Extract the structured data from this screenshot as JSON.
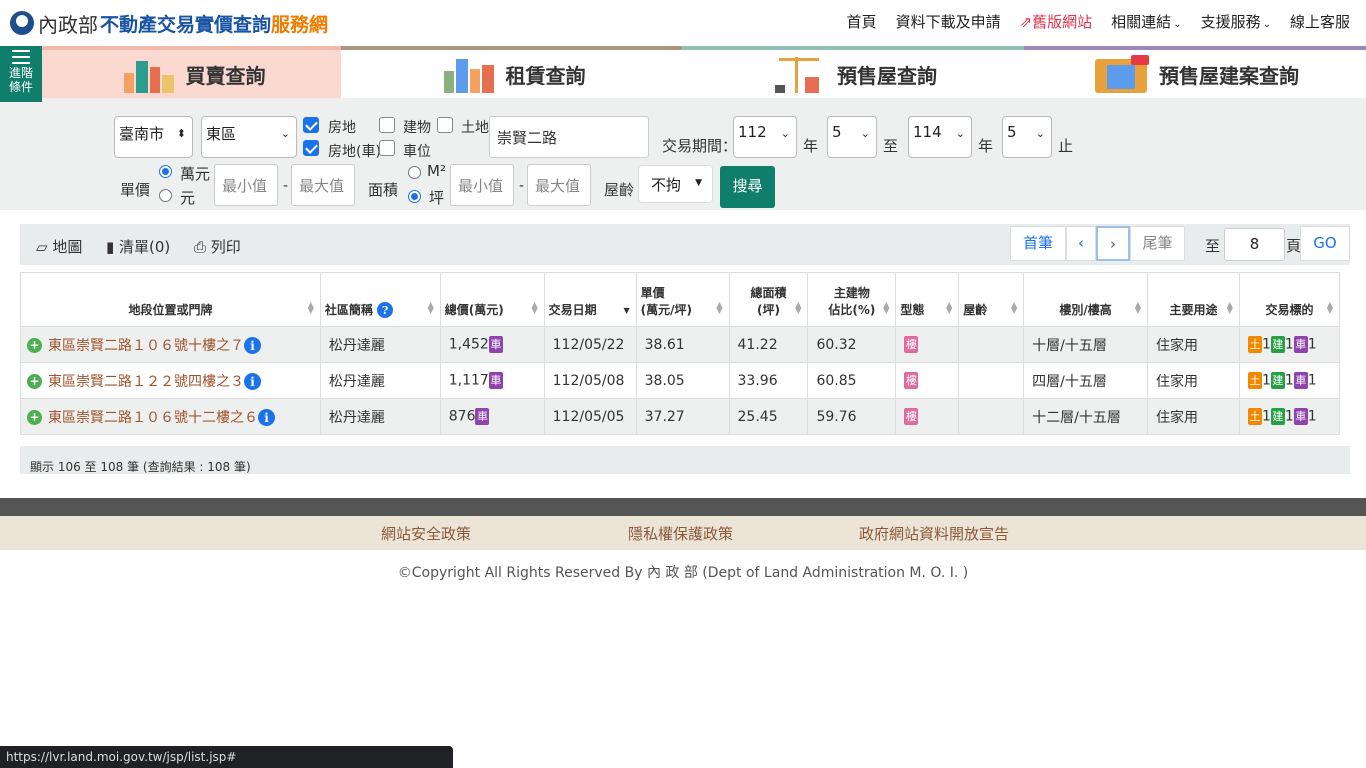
{
  "header": {
    "ministry": "內政部",
    "title": "不動產交易實價查詢",
    "title_suffix": "服務網",
    "nav": [
      "首頁",
      "資料下載及申請",
      "舊版網站",
      "相關連結",
      "支援服務",
      "線上客服"
    ]
  },
  "advanced": {
    "label1": "進階",
    "label2": "條件"
  },
  "tabs": [
    {
      "label": "買賣查詢"
    },
    {
      "label": "租賃查詢"
    },
    {
      "label": "預售屋查詢"
    },
    {
      "label": "預售屋建案查詢"
    }
  ],
  "filters": {
    "city": "臺南市",
    "district": "東區",
    "types": [
      {
        "label": "房地",
        "checked": true
      },
      {
        "label": "建物",
        "checked": false
      },
      {
        "label": "土地",
        "checked": false
      },
      {
        "label": "房地(車)",
        "checked": true
      },
      {
        "label": "車位",
        "checked": false
      }
    ],
    "road": "崇賢二路",
    "period_label": "交易期間：",
    "from_year": "112",
    "year_unit": "年",
    "from_month": "5",
    "to_label": "至",
    "to_year": "114",
    "to_month": "5",
    "end_label": "止",
    "unit_price_label": "單價",
    "unit_opt1": "萬元",
    "unit_opt2": "元",
    "min_placeholder": "最小值",
    "max_placeholder": "最大值",
    "dash": "-",
    "area_label": "面積",
    "area_opt1": "M²",
    "area_opt2": "坪",
    "age_label": "屋齡",
    "age_value": "不拘",
    "search_button": "搜尋"
  },
  "toolbar": {
    "map": "地圖",
    "list": "清單(0)",
    "print": "列印",
    "first": "首筆",
    "prev": "‹",
    "next": "›",
    "last": "尾筆",
    "goto_label": "至",
    "page_value": "8",
    "page_unit": "頁",
    "go": "GO"
  },
  "table": {
    "headers": [
      "地段位置或門牌",
      "社區簡稱",
      "總價(萬元)",
      "交易日期",
      "單價\n(萬元/坪)",
      "總面積\n(坪)",
      "主建物\n佔比(%)",
      "型態",
      "屋齡",
      "樓別/樓高",
      "主要用途",
      "交易標的"
    ],
    "rows": [
      {
        "address": "東區崇賢二路１０６號十樓之７",
        "community": "松丹達麗",
        "total": "1,452",
        "date": "112/05/22",
        "unit": "38.61",
        "area": "41.22",
        "ratio": "60.32",
        "type": "樓",
        "age": "",
        "floor": "十層/十五層",
        "use": "住家用",
        "land": "1",
        "bld": "1",
        "car": "1"
      },
      {
        "address": "東區崇賢二路１２２號四樓之３",
        "community": "松丹達麗",
        "total": "1,117",
        "date": "112/05/08",
        "unit": "38.05",
        "area": "33.96",
        "ratio": "60.85",
        "type": "樓",
        "age": "",
        "floor": "四層/十五層",
        "use": "住家用",
        "land": "1",
        "bld": "1",
        "car": "1"
      },
      {
        "address": "東區崇賢二路１０６號十二樓之６",
        "community": "松丹達麗",
        "total": "876",
        "date": "112/05/05",
        "unit": "37.27",
        "area": "25.45",
        "ratio": "59.76",
        "type": "樓",
        "age": "",
        "floor": "十二層/十五層",
        "use": "住家用",
        "land": "1",
        "bld": "1",
        "car": "1"
      }
    ],
    "badges": {
      "car": "車",
      "land": "土",
      "bld": "建"
    }
  },
  "result_text": "顯示 106 至 108 筆 (查詢結果 : 108 筆)",
  "footer": {
    "policy1": "網站安全政策",
    "policy2": "隱私權保護政策",
    "policy3": "政府網站資料開放宣告",
    "copyright": "©Copyright All Rights Reserved By 內 政 部 (Dept of Land Administration M. O. I. )"
  },
  "status_url": "https://lvr.land.moi.gov.tw/jsp/list.jsp#"
}
